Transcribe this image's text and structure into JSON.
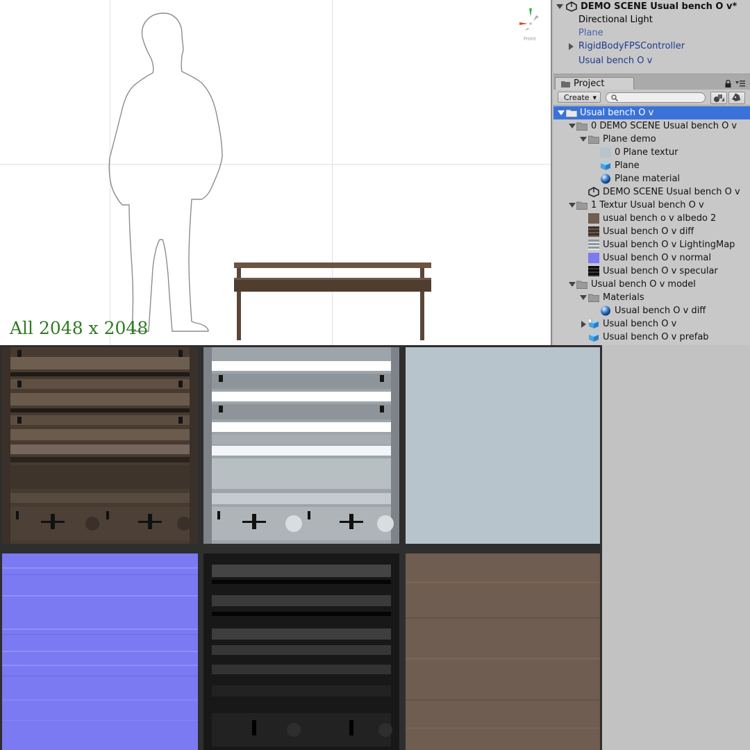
{
  "scene": {
    "dimensions_label": "All 2048 x 2048",
    "gizmo_label": "Front",
    "colors": {
      "background": "#ffffff",
      "grid": "#e1e1e1",
      "label": "#2f7a22"
    }
  },
  "hierarchy": {
    "scene_title": "DEMO SCENE Usual bench O v*",
    "items": [
      {
        "label": "Directional Light"
      },
      {
        "label": "Plane"
      },
      {
        "label": "RigidBodyFPSController"
      },
      {
        "label": "Usual bench O v"
      }
    ]
  },
  "project": {
    "tab_label": "Project",
    "create_label": "Create",
    "search_placeholder": "",
    "tree": [
      {
        "label": "Usual bench O v",
        "icon": "folder-icon",
        "selected": true
      },
      {
        "label": "0 DEMO SCENE  Usual bench O v",
        "icon": "folder-icon"
      },
      {
        "label": "Plane demo",
        "icon": "folder-icon"
      },
      {
        "label": "0 Plane textur",
        "icon": "texture-icon"
      },
      {
        "label": "Plane",
        "icon": "mesh-cube-icon"
      },
      {
        "label": "Plane material",
        "icon": "material-sphere-icon"
      },
      {
        "label": "DEMO SCENE Usual bench O v",
        "icon": "unity-scene-icon"
      },
      {
        "label": "1 Textur Usual bench O v",
        "icon": "folder-icon"
      },
      {
        "label": "usual bench o v albedo 2",
        "icon": "texture-icon"
      },
      {
        "label": "Usual bench O v diff",
        "icon": "texture-icon"
      },
      {
        "label": "Usual bench O v LightingMap",
        "icon": "texture-icon"
      },
      {
        "label": "Usual bench O v normal",
        "icon": "texture-icon"
      },
      {
        "label": "Usual bench O v specular",
        "icon": "texture-icon"
      },
      {
        "label": "Usual bench O v model",
        "icon": "folder-icon"
      },
      {
        "label": "Materials",
        "icon": "folder-icon"
      },
      {
        "label": "Usual bench O v diff",
        "icon": "material-sphere-icon"
      },
      {
        "label": "Usual bench O v",
        "icon": "model-prefab-icon"
      },
      {
        "label": "Usual bench O v prefab",
        "icon": "prefab-cube-icon"
      }
    ],
    "colors": {
      "selection": "#3a72d8",
      "panel": "#c8c8c8"
    }
  },
  "textures": [
    {
      "name": "diffuse",
      "color": "#4a4037"
    },
    {
      "name": "lighting-map",
      "color": "#a9b2b8"
    },
    {
      "name": "plane-texture",
      "color": "#b7c4cb"
    },
    {
      "name": "normal",
      "color": "#7a7af2"
    },
    {
      "name": "specular",
      "color": "#1c1c1c"
    },
    {
      "name": "albedo",
      "color": "#6e5d50"
    }
  ]
}
